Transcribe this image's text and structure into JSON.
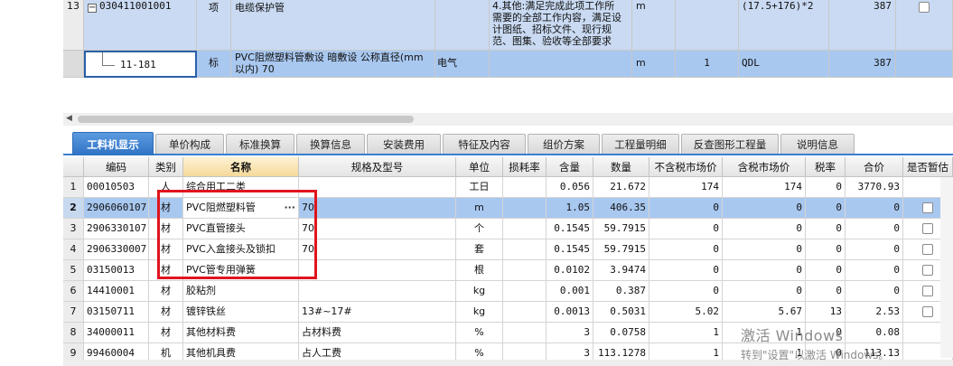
{
  "top_rows": [
    {
      "row_num": "13",
      "expand": "−",
      "code": "030411001001",
      "type": "项",
      "name": "电缆保护管",
      "spec_lines": [
        "4.其他:满足完成此项工作所",
        "需要的全部工作内容，满足设",
        "计图纸、招标文件、现行规",
        "范、图集、验收等全部要求"
      ],
      "unit": "m",
      "qty_expr": "(17.5+176)*2",
      "amount": "387"
    },
    {
      "row_num": "",
      "code": "11-181",
      "type": "标",
      "name": "PVC阻燃塑料管敷设 暗敷设 公称直径(mm以内) 70",
      "major": "电气",
      "unit": "m",
      "content": "1",
      "qty_expr": "QDL",
      "amount": "387"
    }
  ],
  "tabs": [
    "工料机显示",
    "单价构成",
    "标准换算",
    "换算信息",
    "安装费用",
    "特征及内容",
    "组价方案",
    "工程量明细",
    "反查图形工程量",
    "说明信息"
  ],
  "columns": [
    "编码",
    "类别",
    "名称",
    "规格及型号",
    "单位",
    "损耗率",
    "含量",
    "数量",
    "不含税市场价",
    "含税市场价",
    "税率",
    "合价",
    "是否暂估"
  ],
  "rows": [
    {
      "n": "1",
      "code": "00010503",
      "cat": "人",
      "name": "综合用工二类",
      "spec": "",
      "unit": "工日",
      "loss": "",
      "content": "0.056",
      "qty": "21.672",
      "price_ex": "174",
      "price_in": "174",
      "tax": "0",
      "total": "3770.93",
      "est": false
    },
    {
      "n": "2",
      "code": "2906060107",
      "cat": "材",
      "name": "PVC阻燃塑料管",
      "spec": "70",
      "unit": "m",
      "loss": "",
      "content": "1.05",
      "qty": "406.35",
      "price_ex": "0",
      "price_in": "0",
      "tax": "0",
      "total": "0",
      "est": true
    },
    {
      "n": "3",
      "code": "2906330107",
      "cat": "材",
      "name": "PVC直管接头",
      "spec": "70",
      "unit": "个",
      "loss": "",
      "content": "0.1545",
      "qty": "59.7915",
      "price_ex": "0",
      "price_in": "0",
      "tax": "0",
      "total": "0",
      "est": true
    },
    {
      "n": "4",
      "code": "2906330007",
      "cat": "材",
      "name": "PVC入盒接头及锁扣",
      "spec": "70",
      "unit": "套",
      "loss": "",
      "content": "0.1545",
      "qty": "59.7915",
      "price_ex": "0",
      "price_in": "0",
      "tax": "0",
      "total": "0",
      "est": true
    },
    {
      "n": "5",
      "code": "03150013",
      "cat": "材",
      "name": "PVC管专用弹簧",
      "spec": "",
      "unit": "根",
      "loss": "",
      "content": "0.0102",
      "qty": "3.9474",
      "price_ex": "0",
      "price_in": "0",
      "tax": "0",
      "total": "0",
      "est": true
    },
    {
      "n": "6",
      "code": "14410001",
      "cat": "材",
      "name": "胶粘剂",
      "spec": "",
      "unit": "kg",
      "loss": "",
      "content": "0.001",
      "qty": "0.387",
      "price_ex": "0",
      "price_in": "0",
      "tax": "0",
      "total": "0",
      "est": true
    },
    {
      "n": "7",
      "code": "03150711",
      "cat": "材",
      "name": "镀锌铁丝",
      "spec": "13#~17#",
      "unit": "kg",
      "loss": "",
      "content": "0.0013",
      "qty": "0.5031",
      "price_ex": "5.02",
      "price_in": "5.67",
      "tax": "13",
      "total": "2.53",
      "est": true
    },
    {
      "n": "8",
      "code": "34000011",
      "cat": "材",
      "name": "其他材料费",
      "spec": "占材料费",
      "unit": "%",
      "loss": "",
      "content": "3",
      "qty": "0.0758",
      "price_ex": "1",
      "price_in": "1",
      "tax": "0",
      "total": "0.08",
      "est": false
    },
    {
      "n": "9",
      "code": "99460004",
      "cat": "机",
      "name": "其他机具费",
      "spec": "占人工费",
      "unit": "%",
      "loss": "",
      "content": "3",
      "qty": "113.1278",
      "price_ex": "1",
      "price_in": "1",
      "tax": "0",
      "total": "113.13",
      "est": false
    }
  ],
  "watermark": {
    "line1": "激活 Windows",
    "line2": "转到\"设置\"以激活 Windows。"
  },
  "colors": {
    "selected_row": "#a9c8f0",
    "active_tab": "#2f72c4",
    "red_box": "#e0141e"
  }
}
